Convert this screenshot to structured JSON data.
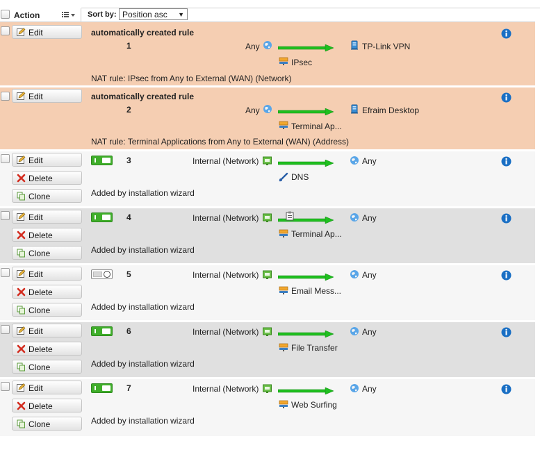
{
  "header": {
    "action_label": "Action",
    "sortby_label": "Sort by:",
    "sort_value": "Position asc"
  },
  "actions": {
    "edit": "Edit",
    "delete": "Delete",
    "clone": "Clone"
  },
  "rules": [
    {
      "kind": "auto",
      "title": "automatically created rule",
      "position": "1",
      "source": "Any",
      "destination": "TP-Link VPN",
      "service": "IPsec",
      "comment": "NAT rule: IPsec from Any to External (WAN) (Network)"
    },
    {
      "kind": "auto",
      "title": "automatically created rule",
      "position": "2",
      "source": "Any",
      "destination": "Efraim Desktop",
      "service": "Terminal Ap...",
      "comment": "NAT rule: Terminal Applications from Any to External (WAN) (Address)"
    },
    {
      "kind": "user",
      "enabled": true,
      "position": "3",
      "source": "Internal (Network)",
      "destination": "Any",
      "service": "DNS",
      "comment": "Added by installation wizard"
    },
    {
      "kind": "user",
      "enabled": true,
      "position": "4",
      "source": "Internal (Network)",
      "destination": "Any",
      "service": "Terminal Ap...",
      "comment": "Added by installation wizard"
    },
    {
      "kind": "user",
      "enabled": false,
      "position": "5",
      "source": "Internal (Network)",
      "destination": "Any",
      "service": "Email Mess...",
      "comment": "Added by installation wizard"
    },
    {
      "kind": "user",
      "enabled": true,
      "position": "6",
      "source": "Internal (Network)",
      "destination": "Any",
      "service": "File Transfer",
      "comment": "Added by installation wizard"
    },
    {
      "kind": "user",
      "enabled": true,
      "position": "7",
      "source": "Internal (Network)",
      "destination": "Any",
      "service": "Web Surfing",
      "comment": "Added by installation wizard"
    }
  ],
  "colors": {
    "auto_row": "#f5ceb2",
    "row_light": "#f6f6f6",
    "row_dark": "#e0e0e0",
    "arrow_green": "#1fbf1f",
    "toggle_on": "#3fae2a",
    "info_blue": "#1a6fc4"
  }
}
